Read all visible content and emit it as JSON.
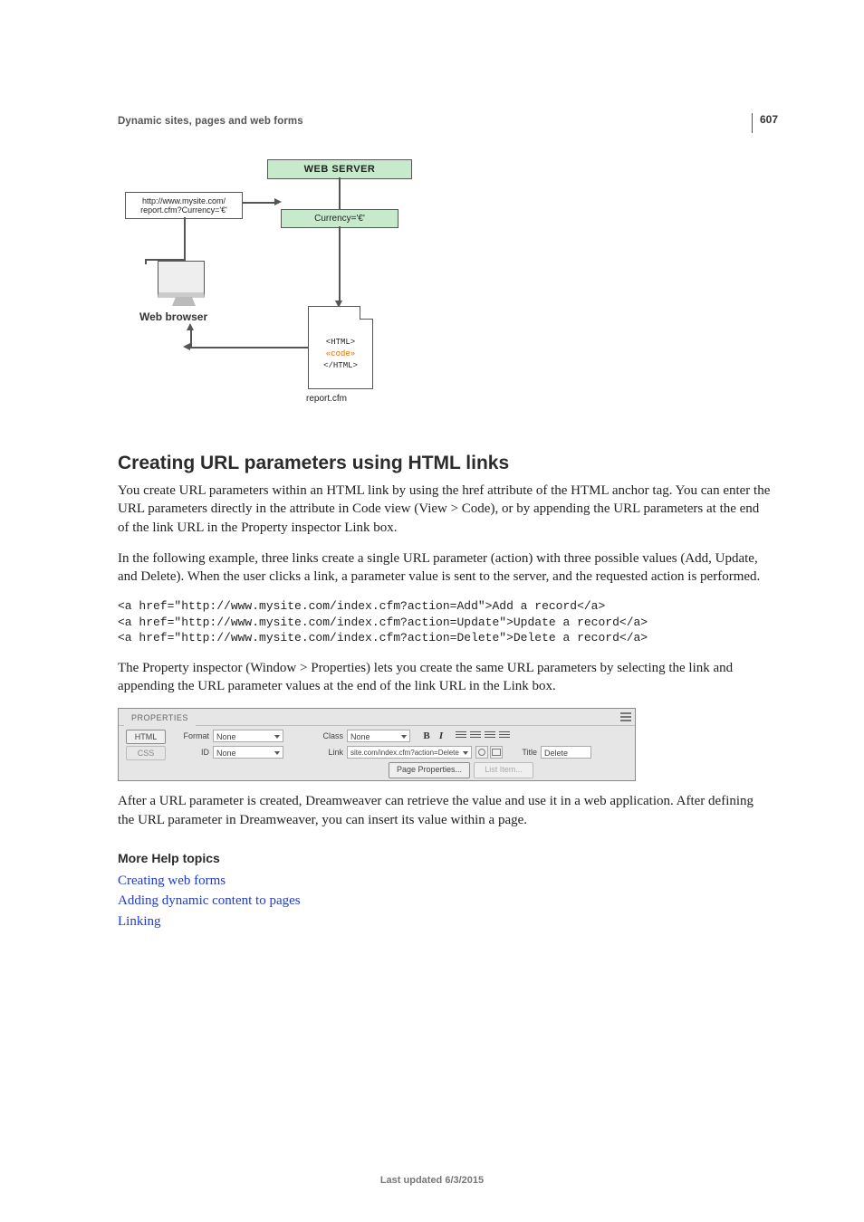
{
  "page_number": "607",
  "header": "Dynamic sites, pages and web forms",
  "diagram": {
    "url_box": "http://www.mysite.com/\nreport.cfm?Currency='€'",
    "web_server": "WEB SERVER",
    "currency": "Currency='€'",
    "web_browser": "Web browser",
    "html_open": "<HTML>",
    "code": "«code»",
    "html_close": "</HTML>",
    "report_cfm": "report.cfm"
  },
  "section_title": "Creating URL parameters using HTML links",
  "para1": "You create URL parameters within an HTML link by using the href attribute of the HTML anchor tag. You can enter the URL parameters directly in the attribute in Code view (View > Code), or by appending the URL parameters at the end of the link URL in the Property inspector Link box.",
  "para2": "In the following example, three links create a single URL parameter (action) with three possible values (Add, Update, and Delete). When the user clicks a link, a parameter value is sent to the server, and the requested action is performed.",
  "code_block": "<a href=\"http://www.mysite.com/index.cfm?action=Add\">Add a record</a>\n<a href=\"http://www.mysite.com/index.cfm?action=Update\">Update a record</a>\n<a href=\"http://www.mysite.com/index.cfm?action=Delete\">Delete a record</a>",
  "para3": "The Property inspector (Window > Properties) lets you create the same URL parameters by selecting the link and appending the URL parameter values at the end of the link URL in the Link box.",
  "props": {
    "tab": "PROPERTIES",
    "html_btn": "HTML",
    "css_btn": "CSS",
    "format_label": "Format",
    "format_value": "None",
    "id_label": "ID",
    "id_value": "None",
    "class_label": "Class",
    "class_value": "None",
    "link_label": "Link",
    "link_value": "site.com/index.cfm?action=Delete",
    "title_label": "Title",
    "title_value": "Delete",
    "page_props": "Page Properties...",
    "list_item": "List Item..."
  },
  "para4": "After a URL parameter is created, Dreamweaver can retrieve the value and use it in a web application. After defining the URL parameter in Dreamweaver, you can insert its value within a page.",
  "more_help_heading": "More Help topics",
  "help_links": [
    "Creating web forms",
    "Adding dynamic content to pages",
    "Linking"
  ],
  "footer": "Last updated 6/3/2015"
}
